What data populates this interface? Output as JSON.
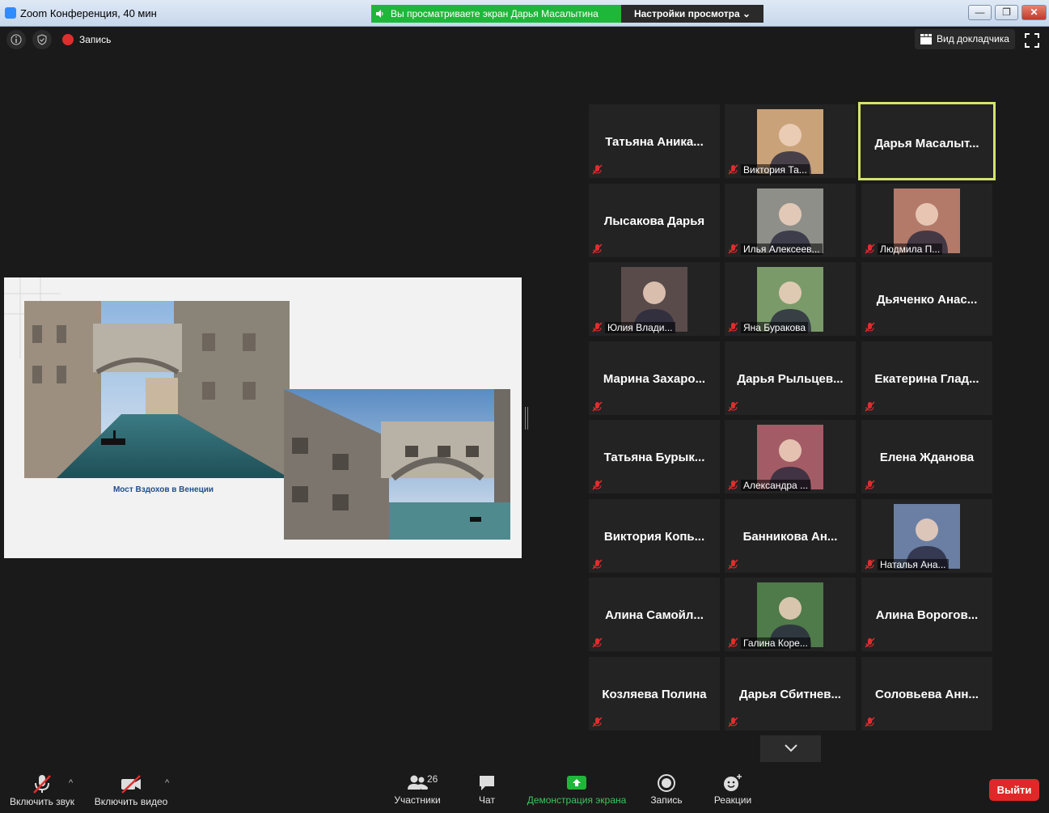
{
  "window": {
    "title": "Zoom Конференция, 40 мин",
    "share_banner": "Вы просматриваете экран Дарья Масалытина",
    "view_settings": "Настройки просмотра ⌄",
    "minimize": "—",
    "maximize": "❐",
    "close": "✕"
  },
  "topbar": {
    "record_label": "Запись",
    "speaker_view_label": "Вид докладчика"
  },
  "shared_screen": {
    "caption": "Мост Вздохов в Венеции"
  },
  "gallery": {
    "tiles": [
      {
        "name": "Татьяна  Аника...",
        "video": false
      },
      {
        "name": "Виктория Та...",
        "video": true
      },
      {
        "name": "Дарья  Масалыт...",
        "video": false,
        "active": true
      },
      {
        "name": "Лысакова Дарья",
        "video": false
      },
      {
        "name": "Илья Алексеев...",
        "video": true
      },
      {
        "name": "Людмила П...",
        "video": true
      },
      {
        "name": "Юлия Влади...",
        "video": true
      },
      {
        "name": "Яна Буракова",
        "video": true
      },
      {
        "name": "Дьяченко  Анас...",
        "video": false
      },
      {
        "name": "Марина  Захаро...",
        "video": false
      },
      {
        "name": "Дарья  Рыльцев...",
        "video": false
      },
      {
        "name": "Екатерина  Глад...",
        "video": false
      },
      {
        "name": "Татьяна  Бурык...",
        "video": false
      },
      {
        "name": "Александра ...",
        "video": true
      },
      {
        "name": "Елена Жданова",
        "video": false
      },
      {
        "name": "Виктория  Копь...",
        "video": false
      },
      {
        "name": "Банникова  Ан...",
        "video": false
      },
      {
        "name": "Наталья Ана...",
        "video": true
      },
      {
        "name": "Алина  Самойл...",
        "video": false
      },
      {
        "name": "Галина Коре...",
        "video": true
      },
      {
        "name": "Алина  Ворогов...",
        "video": false
      },
      {
        "name": "Козляева Полина",
        "video": false
      },
      {
        "name": "Дарья  Сбитнев...",
        "video": false
      },
      {
        "name": "Соловьева  Анн...",
        "video": false
      }
    ]
  },
  "toolbar": {
    "unmute": "Включить звук",
    "start_video": "Включить видео",
    "participants": "Участники",
    "participants_count": "26",
    "chat": "Чат",
    "share_screen": "Демонстрация экрана",
    "record": "Запись",
    "reactions": "Реакции",
    "leave": "Выйти"
  },
  "colors": {
    "share_banner": "#1fb73a",
    "leave": "#e02828",
    "active_speaker": "#d4e46a",
    "mute_icon": "#e02d2d"
  }
}
